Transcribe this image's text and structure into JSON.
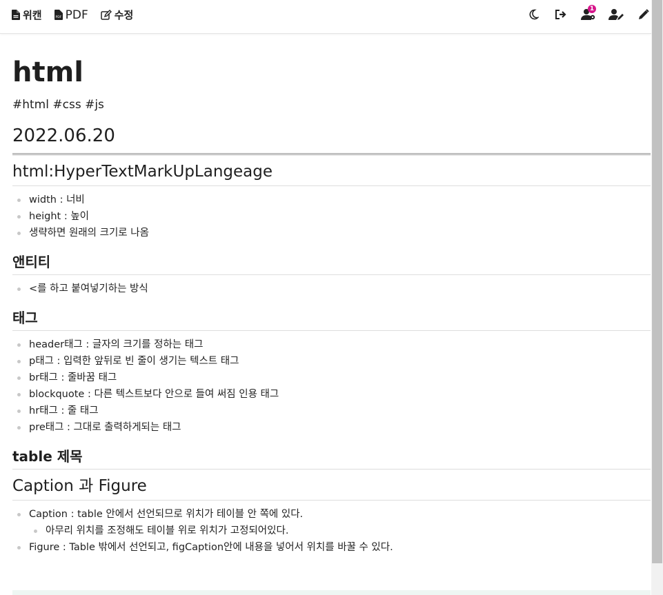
{
  "toolbar": {
    "wiki_label": "위캔",
    "pdf_label": "PDF",
    "edit_label": "수정",
    "notification_count": "1",
    "badge_color": "#d6168b"
  },
  "page": {
    "title": "html",
    "tags": "#html #css #js",
    "date": "2022.06.20"
  },
  "sections": {
    "html": {
      "heading": "html:HyperTextMarkUpLangeage",
      "items": [
        "width : 너비",
        "height : 높이",
        "생략하면 원래의 크기로 나옴"
      ]
    },
    "entity": {
      "heading": "앤티티",
      "items": [
        "<를 하고 붙여넣기하는 방식"
      ]
    },
    "tag": {
      "heading": "태그",
      "items": [
        "header태그 : 글자의 크기를 정하는 태그",
        "p태그 : 입력한 앞뒤로 빈 줄이 생기는 텍스트 태그",
        "br태그 : 줄바꿈 태그",
        "blockquote : 다른 텍스트보다 안으로 들여 써짐 인용 태그",
        "hr태그 : 줄 태그",
        "pre태그 : 그대로 출력하게되는 태그"
      ]
    },
    "table": {
      "heading": "table 제목"
    },
    "caption": {
      "heading": "Caption 과 Figure",
      "items": [
        "Caption : table 안에서 선언되므로 위치가 테이블 안 쪽에 있다.",
        "아무리 위치를 조정해도 테이블 위로 위치가 고정되어있다.",
        "Figure : Table 밖에서 선언되고, figCaption안에 내용을 넣어서 위치를 바꿀 수 있다."
      ]
    }
  },
  "icons": [
    "file-icon",
    "pdf-icon",
    "edit-icon",
    "moon-icon",
    "logout-icon",
    "user-gear-icon",
    "user-pen-icon",
    "pencil-icon"
  ]
}
